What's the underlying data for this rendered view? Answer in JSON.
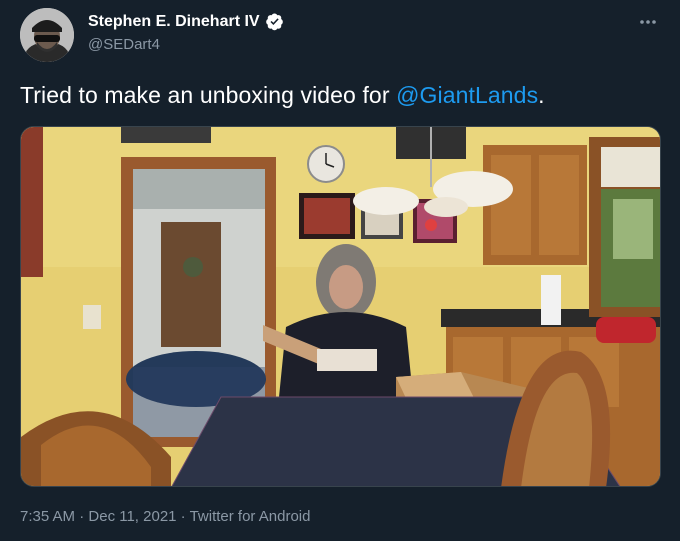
{
  "author": {
    "display_name": "Stephen E. Dinehart IV",
    "handle": "@SEDart4",
    "verified": true
  },
  "tweet": {
    "text_before": "Tried to make an unboxing video for ",
    "mention": "@GiantLands",
    "text_after": "."
  },
  "meta": {
    "time": "7:35 AM",
    "separator": " · ",
    "date": "Dec 11, 2021",
    "source": "Twitter for Android"
  },
  "colors": {
    "background": "#15202b",
    "text_primary": "#ffffff",
    "text_secondary": "#8b98a5",
    "link": "#1d9bf0",
    "border": "#38444d"
  },
  "icons": {
    "verified": "verified-badge-icon",
    "more": "more-options-icon"
  },
  "media": {
    "type": "video-thumbnail",
    "description_hidden": true
  }
}
